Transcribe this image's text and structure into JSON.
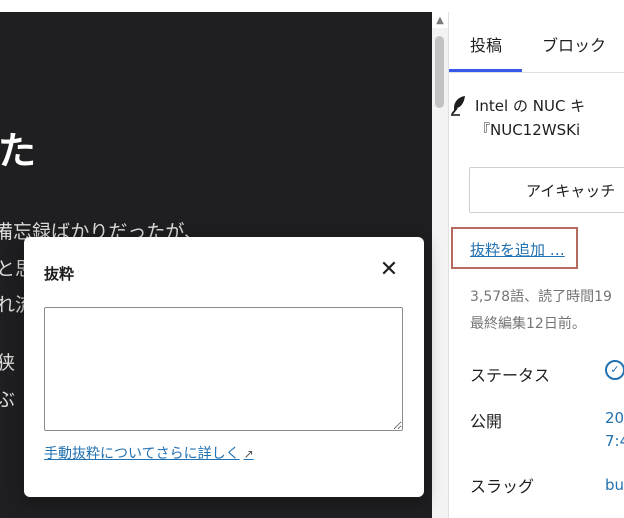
{
  "editor": {
    "heading_fragment": "た",
    "lines": [
      "備忘録ばかりだったが、",
      "と思",
      "れ流",
      "狭",
      "ぶ"
    ]
  },
  "sidebar": {
    "tabs": [
      {
        "label": "投稿",
        "active": true
      },
      {
        "label": "ブロック",
        "active": false
      }
    ],
    "post_title_line1": "Intel の NUC キ",
    "post_title_line2": "『NUC12WSKi",
    "featured_image_label": "アイキャッチ",
    "add_excerpt_label": "抜粋を追加 …",
    "word_count": "3,578語、読了時間19",
    "last_edited": "最終編集12日前。",
    "status_label": "ステータス",
    "publish_label": "公開",
    "publish_value_line1": "20",
    "publish_value_line2": "7:4",
    "slug_label": "スラッグ",
    "slug_value": "bu"
  },
  "modal": {
    "title": "抜粋",
    "textarea_value": "",
    "learn_more_label": "手動抜粋についてさらに詳しく",
    "learn_more_arrow": "↗"
  },
  "colors": {
    "accent": "#2271b1",
    "tab_active": "#3858e9",
    "highlight_border": "#b46a5c",
    "editor_bg": "#1f1f21"
  }
}
